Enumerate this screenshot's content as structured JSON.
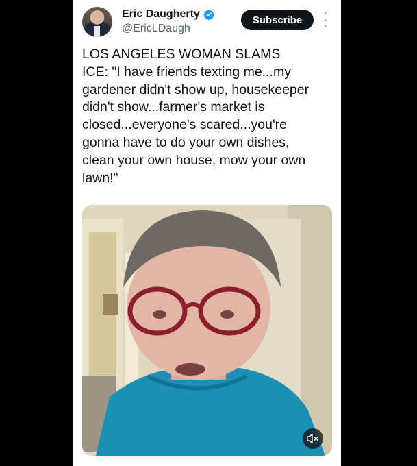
{
  "author": {
    "display_name": "Eric Daugherty",
    "handle": "@EricLDaugh"
  },
  "actions": {
    "subscribe_label": "Subscribe"
  },
  "tweet": {
    "text": "LOS ANGELES WOMAN SLAMS\nICE: \"I have friends texting me...my\ngardener didn't show up, housekeeper\ndidn't show...farmer's market is\nclosed...everyone's scared...you're\ngonna have to do your own dishes,\nclean your own house, mow your own\nlawn!\""
  },
  "media": {
    "type": "video",
    "muted": true,
    "mute_icon": "speaker-muted-icon"
  },
  "colors": {
    "background": "#000000",
    "card": "#ffffff",
    "text": "#0f1419",
    "secondary_text": "#536471",
    "verified": "#1d9bf0",
    "subscribe_bg": "#0f1419"
  }
}
